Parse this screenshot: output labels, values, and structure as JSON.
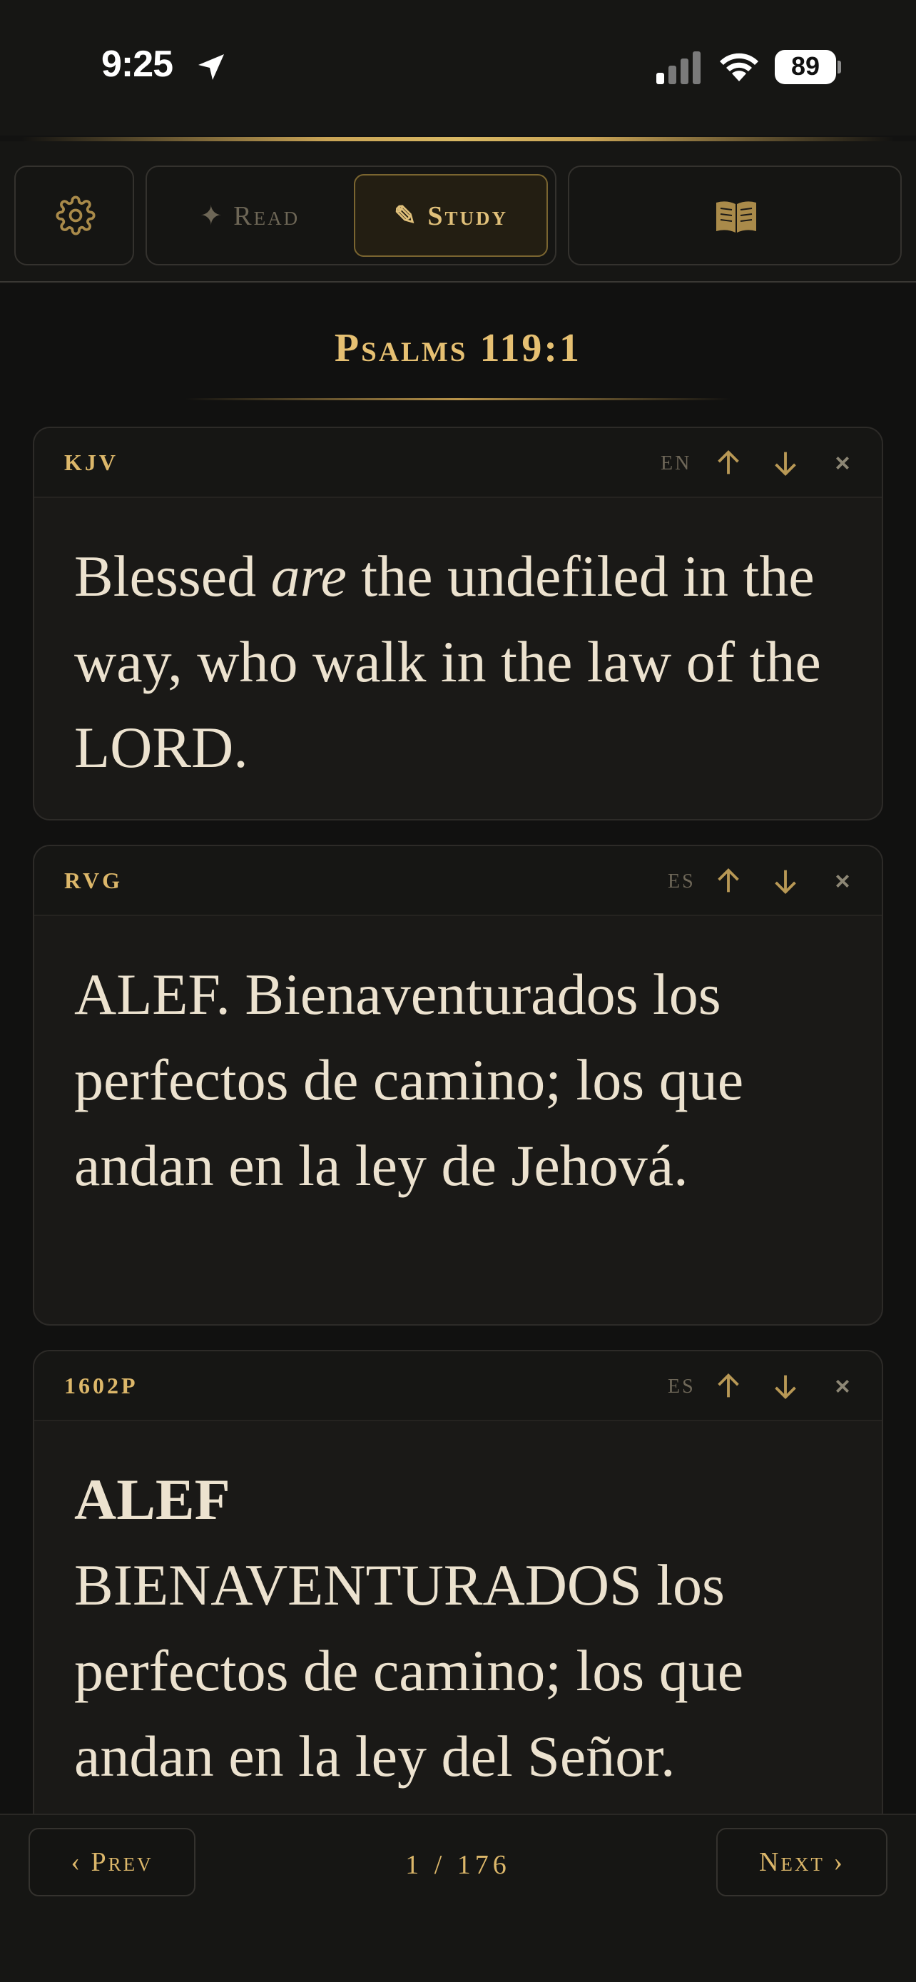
{
  "status_bar": {
    "time": "9:25",
    "battery": "89"
  },
  "toolbar": {
    "read_label": "✦ Read",
    "study_label": "✎ Study"
  },
  "reference": "Psalms 119:1",
  "cards": [
    {
      "version": "KJV",
      "lang": "EN",
      "text_parts": [
        "Blessed ",
        "are",
        " the undefiled in the way, who walk in the law of the LORD."
      ]
    },
    {
      "version": "RVG",
      "lang": "ES",
      "text": "ALEF. Bienaventurados los perfectos de camino; los que andan en la ley de Jehová."
    },
    {
      "version": "1602P",
      "lang": "ES",
      "text_bold": "ALEF",
      "text": "BIENAVENTURADOS los perfectos de camino; los que andan en la ley del Señor."
    }
  ],
  "bottom_nav": {
    "prev_label": "‹ Prev",
    "next_label": "Next ›",
    "page_indicator": "1 / 176"
  },
  "colors": {
    "accent_gold": "#dcb76a",
    "background": "#111110",
    "card_bg": "#1a1917",
    "text": "#ece2cf"
  }
}
